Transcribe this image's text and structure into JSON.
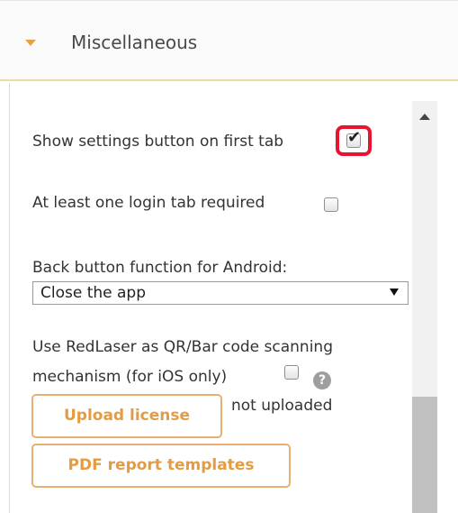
{
  "section": {
    "title": "Miscellaneous",
    "expanded": true
  },
  "settings": {
    "show_settings_button": {
      "label": "Show settings button on first tab",
      "checked": true
    },
    "login_tab_required": {
      "label": "At least one login tab required",
      "checked": false
    },
    "back_button": {
      "label": "Back button function for Android:",
      "selected": "Close the app"
    },
    "redlaser": {
      "label_line1": "Use RedLaser as QR/Bar code scanning",
      "label_line2": "mechanism (for iOS only)",
      "checked": false,
      "help": "?",
      "license_status": "not uploaded"
    }
  },
  "buttons": {
    "upload_license": "Upload license",
    "pdf_templates": "PDF report templates"
  },
  "colors": {
    "accent": "#e39c43",
    "highlight": "#e8142f"
  },
  "icons": {
    "caret": "caret-down-icon",
    "help": "question-circle-icon",
    "checkmark": "checkmark-icon",
    "scroll_up": "scroll-up-arrow-icon",
    "dropdown": "dropdown-arrow-icon"
  }
}
